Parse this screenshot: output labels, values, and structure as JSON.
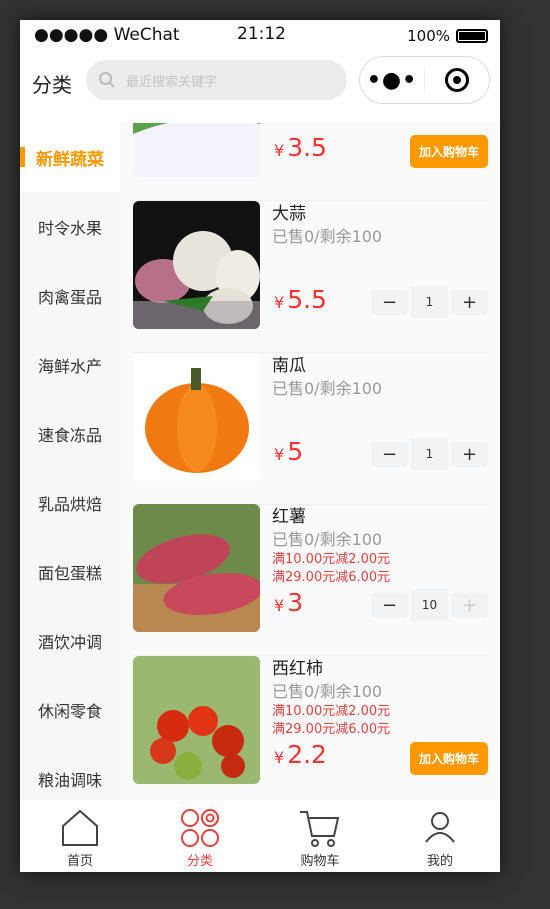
{
  "status": {
    "carrier": "●●●●● WeChat",
    "time": "21:12",
    "battery": "100%"
  },
  "nav": {
    "title": "分类",
    "search_placeholder": "最近搜索关键字"
  },
  "sidebar": {
    "items": [
      {
        "label": "新鲜蔬菜",
        "active": true
      },
      {
        "label": "时令水果"
      },
      {
        "label": "肉禽蛋品"
      },
      {
        "label": "海鲜水产"
      },
      {
        "label": "速食冻品"
      },
      {
        "label": "乳品烘焙"
      },
      {
        "label": "面包蛋糕"
      },
      {
        "label": "酒饮冲调"
      },
      {
        "label": "休闲零食"
      },
      {
        "label": "粮油调味"
      }
    ]
  },
  "currency": "¥",
  "products": [
    {
      "name": "",
      "sold": "",
      "price": "3.5",
      "action": "加入购物车"
    },
    {
      "name": "大蒜",
      "sold": "已售0/剩余100",
      "price": "5.5",
      "qty": "1"
    },
    {
      "name": "南瓜",
      "sold": "已售0/剩余100",
      "price": "5",
      "qty": "1"
    },
    {
      "name": "红薯",
      "sold": "已售0/剩余100",
      "promos": [
        "满10.00元减2.00元",
        "满29.00元减6.00元"
      ],
      "price": "3",
      "qty": "10"
    },
    {
      "name": "西红柿",
      "sold": "已售0/剩余100",
      "promos": [
        "满10.00元减2.00元",
        "满29.00元减6.00元"
      ],
      "price": "2.2",
      "action": "加入购物车"
    }
  ],
  "stepper": {
    "minus": "−",
    "plus": "+"
  },
  "tabbar": [
    {
      "label": "首页"
    },
    {
      "label": "分类",
      "active": true
    },
    {
      "label": "购物车"
    },
    {
      "label": "我的"
    }
  ],
  "colors": {
    "accent": "#ff9900",
    "price": "#ff3333",
    "promo": "#e64340"
  }
}
